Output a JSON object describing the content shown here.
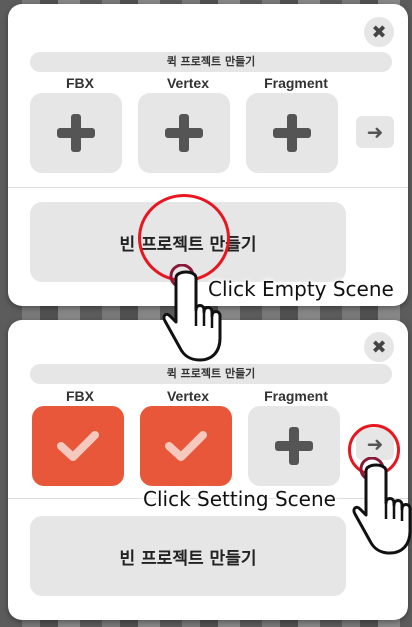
{
  "panel_top": {
    "close_icon": "✖",
    "section_title": "퀵 프로젝트 만들기",
    "slots": [
      {
        "label": "FBX",
        "state": "empty"
      },
      {
        "label": "Vertex",
        "state": "empty"
      },
      {
        "label": "Fragment",
        "state": "empty"
      }
    ],
    "arrow_icon": "➜",
    "empty_project_button": "빈 프로젝트 만들기",
    "callout": "Click Empty Scene"
  },
  "panel_bottom": {
    "close_icon": "✖",
    "section_title": "퀵 프로젝트 만들기",
    "slots": [
      {
        "label": "FBX",
        "state": "checked"
      },
      {
        "label": "Vertex",
        "state": "checked"
      },
      {
        "label": "Fragment",
        "state": "empty"
      }
    ],
    "arrow_icon": "➜",
    "empty_project_button": "빈 프로젝트 만들기",
    "callout": "Click Setting Scene"
  },
  "colors": {
    "accent": "#e8573a",
    "highlight_ring": "#e8161f",
    "slot_bg": "#e6e6e6",
    "icon": "#555555"
  },
  "icons": {
    "plus": "plus-icon",
    "check": "check-icon",
    "arrow": "arrow-right-icon",
    "close": "close-icon",
    "pointer": "pointing-hand-icon"
  }
}
